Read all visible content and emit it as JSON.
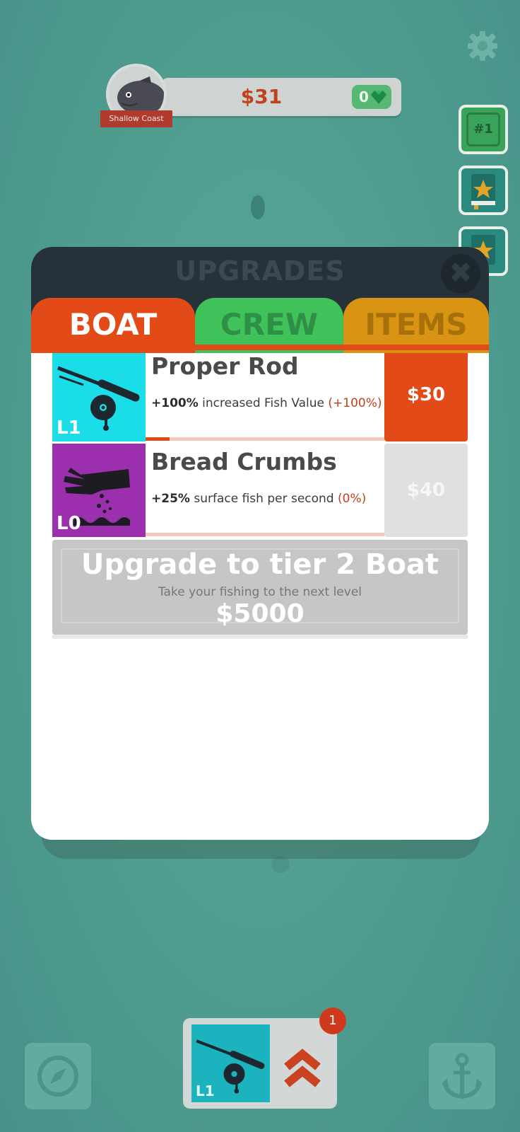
{
  "hud": {
    "money": "$31",
    "gems": "0",
    "location": "Shallow Coast",
    "rank": "#1"
  },
  "modal": {
    "title": "UPGRADES",
    "close_symbol": "✖",
    "tabs": [
      {
        "label": "BOAT",
        "active": true
      },
      {
        "label": "CREW",
        "active": false
      },
      {
        "label": "ITEMS",
        "active": false
      }
    ],
    "upgrades": [
      {
        "name": "Proper Rod",
        "level": "L1",
        "effect_bold": "+100%",
        "effect_text": "increased Fish Value",
        "effect_change": "(+100%)",
        "price": "$30",
        "affordable": true,
        "progress": 0.1,
        "icon": "fishing-rod-icon"
      },
      {
        "name": "Bread Crumbs",
        "level": "L0",
        "effect_bold": "+25%",
        "effect_text": "surface fish per second",
        "effect_change": "(0%)",
        "price": "$40",
        "affordable": false,
        "progress": 0,
        "icon": "hand-crumbs-icon"
      }
    ],
    "tier_upgrade": {
      "title": "Upgrade to tier 2 Boat",
      "subtitle": "Take your fishing to the next level",
      "price": "$5000"
    }
  },
  "bottom_bar": {
    "current_level": "L1",
    "notification_count": "1"
  },
  "colors": {
    "boat_tab": "#e24a17",
    "crew_tab": "#3fc25a",
    "items_tab": "#d89412",
    "money_text": "#c0421d",
    "rod_bg": "#1bdde8",
    "crumbs_bg": "#9b2fad"
  }
}
